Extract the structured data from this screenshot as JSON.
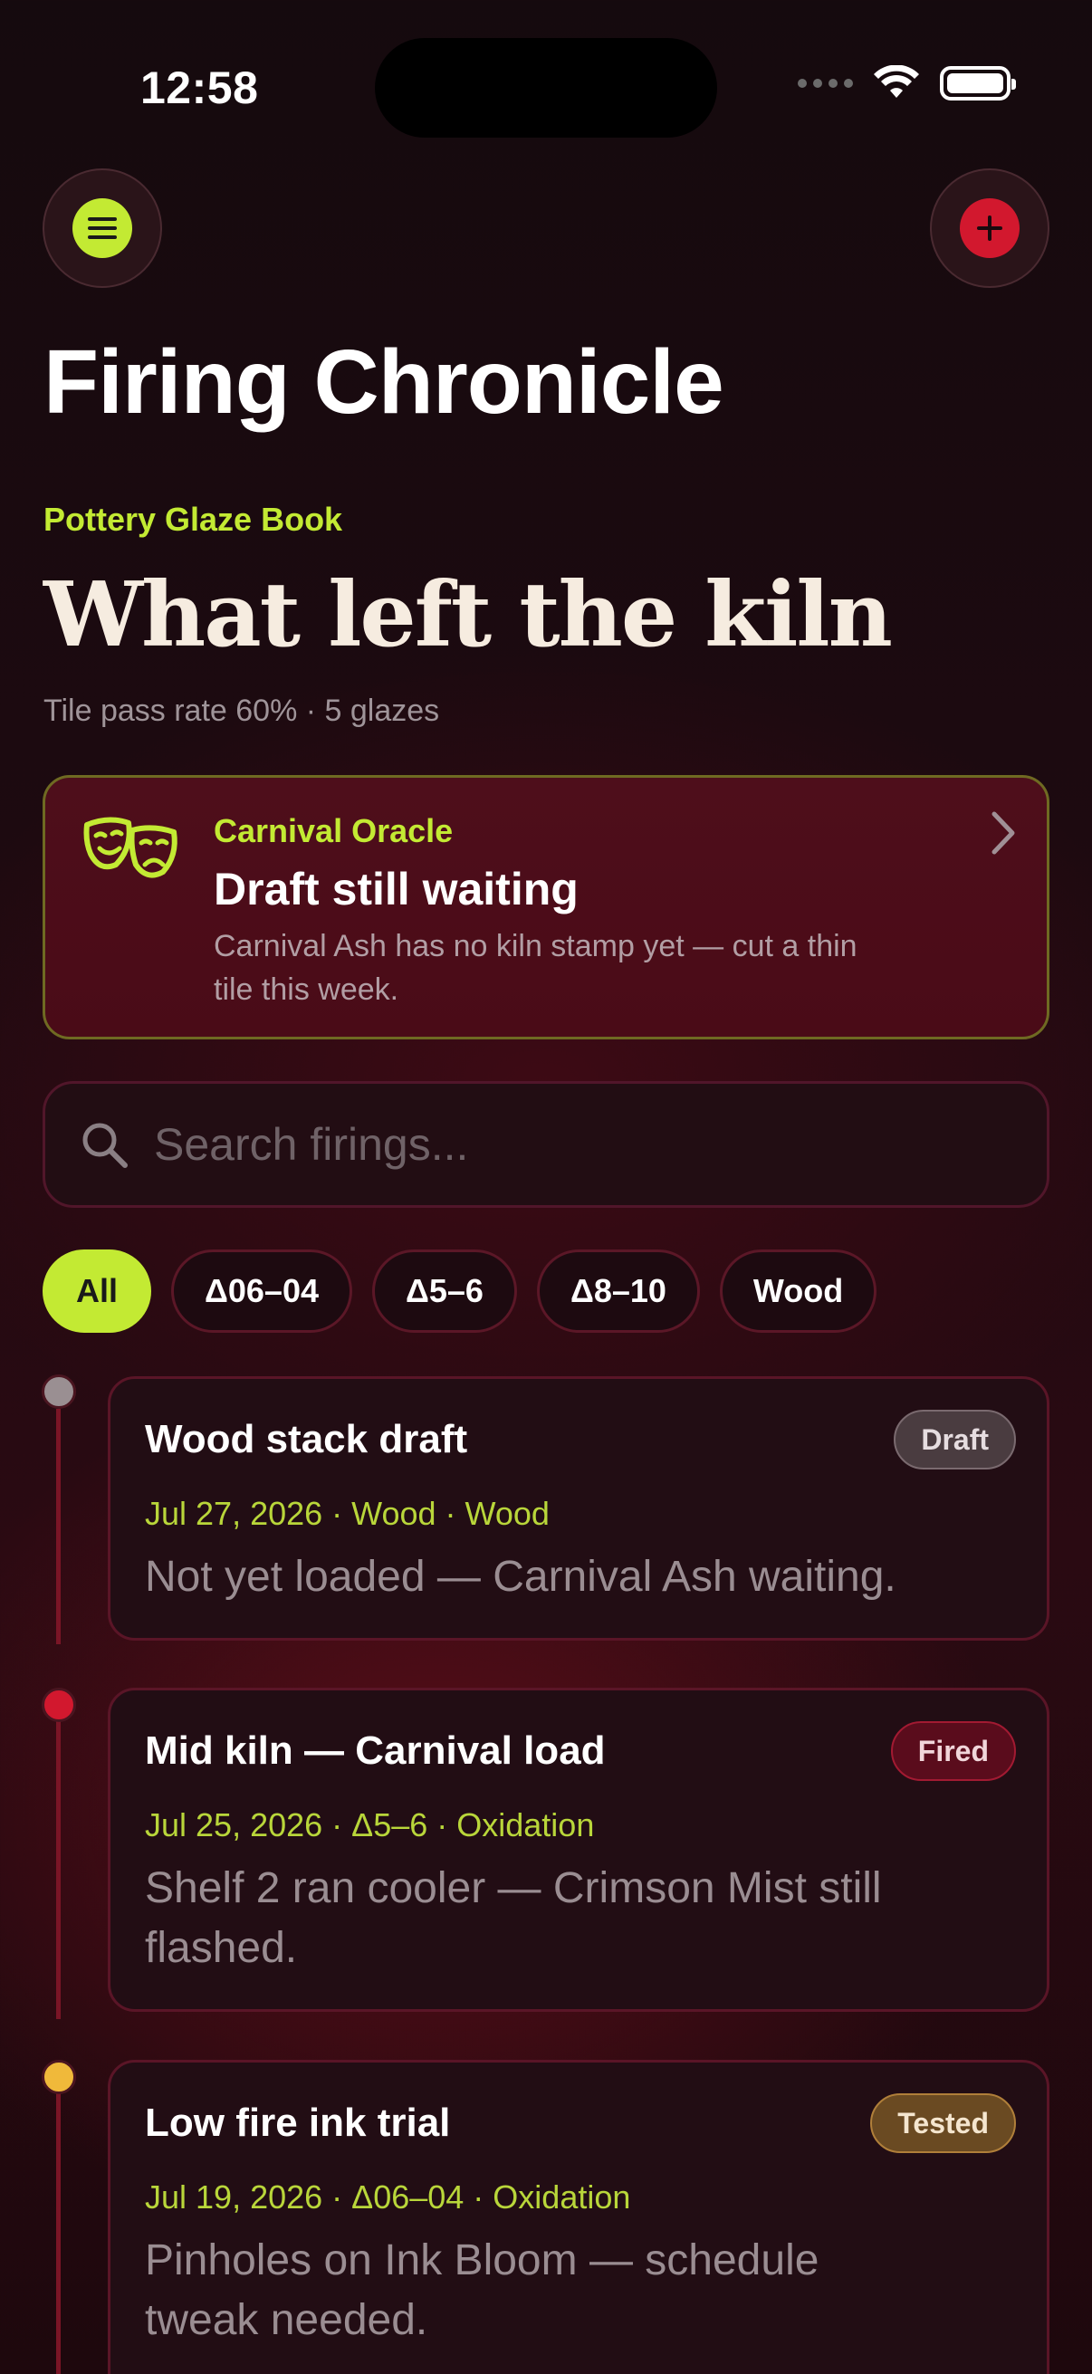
{
  "status_bar": {
    "time": "12:58"
  },
  "header": {
    "app_title": "Firing Chronicle"
  },
  "section": {
    "eyebrow": "Pottery Glaze Book",
    "heading": "What left the kiln",
    "subtitle": "Tile pass rate 60% · 5 glazes"
  },
  "oracle": {
    "label": "Carnival Oracle",
    "title": "Draft still waiting",
    "text": "Carnival Ash has no kiln stamp yet — cut a thin tile this week."
  },
  "search": {
    "placeholder": "Search firings..."
  },
  "filters": [
    {
      "label": "All",
      "active": true
    },
    {
      "label": "Δ06–04",
      "active": false
    },
    {
      "label": "Δ5–6",
      "active": false
    },
    {
      "label": "Δ8–10",
      "active": false
    },
    {
      "label": "Wood",
      "active": false
    }
  ],
  "entries": [
    {
      "title": "Wood stack draft",
      "meta": "Jul 27, 2026 · Wood · Wood",
      "note": "Not yet loaded — Carnival Ash waiting.",
      "badge": "Draft",
      "dot_color": "#9a8f92"
    },
    {
      "title": "Mid kiln — Carnival load",
      "meta": "Jul 25, 2026 · Δ5–6 · Oxidation",
      "note": "Shelf 2 ran cooler — Crimson Mist still flashed.",
      "badge": "Fired",
      "dot_color": "#d2182e"
    },
    {
      "title": "Low fire ink trial",
      "meta": "Jul 19, 2026 · Δ06–04 · Oxidation",
      "note": "Pinholes on Ink Bloom — schedule tweak needed.",
      "badge": "Tested",
      "dot_color": "#f0b93a"
    }
  ],
  "colors": {
    "accent": "#c3ea33",
    "danger": "#d2182e",
    "background": "#1d0a10"
  }
}
